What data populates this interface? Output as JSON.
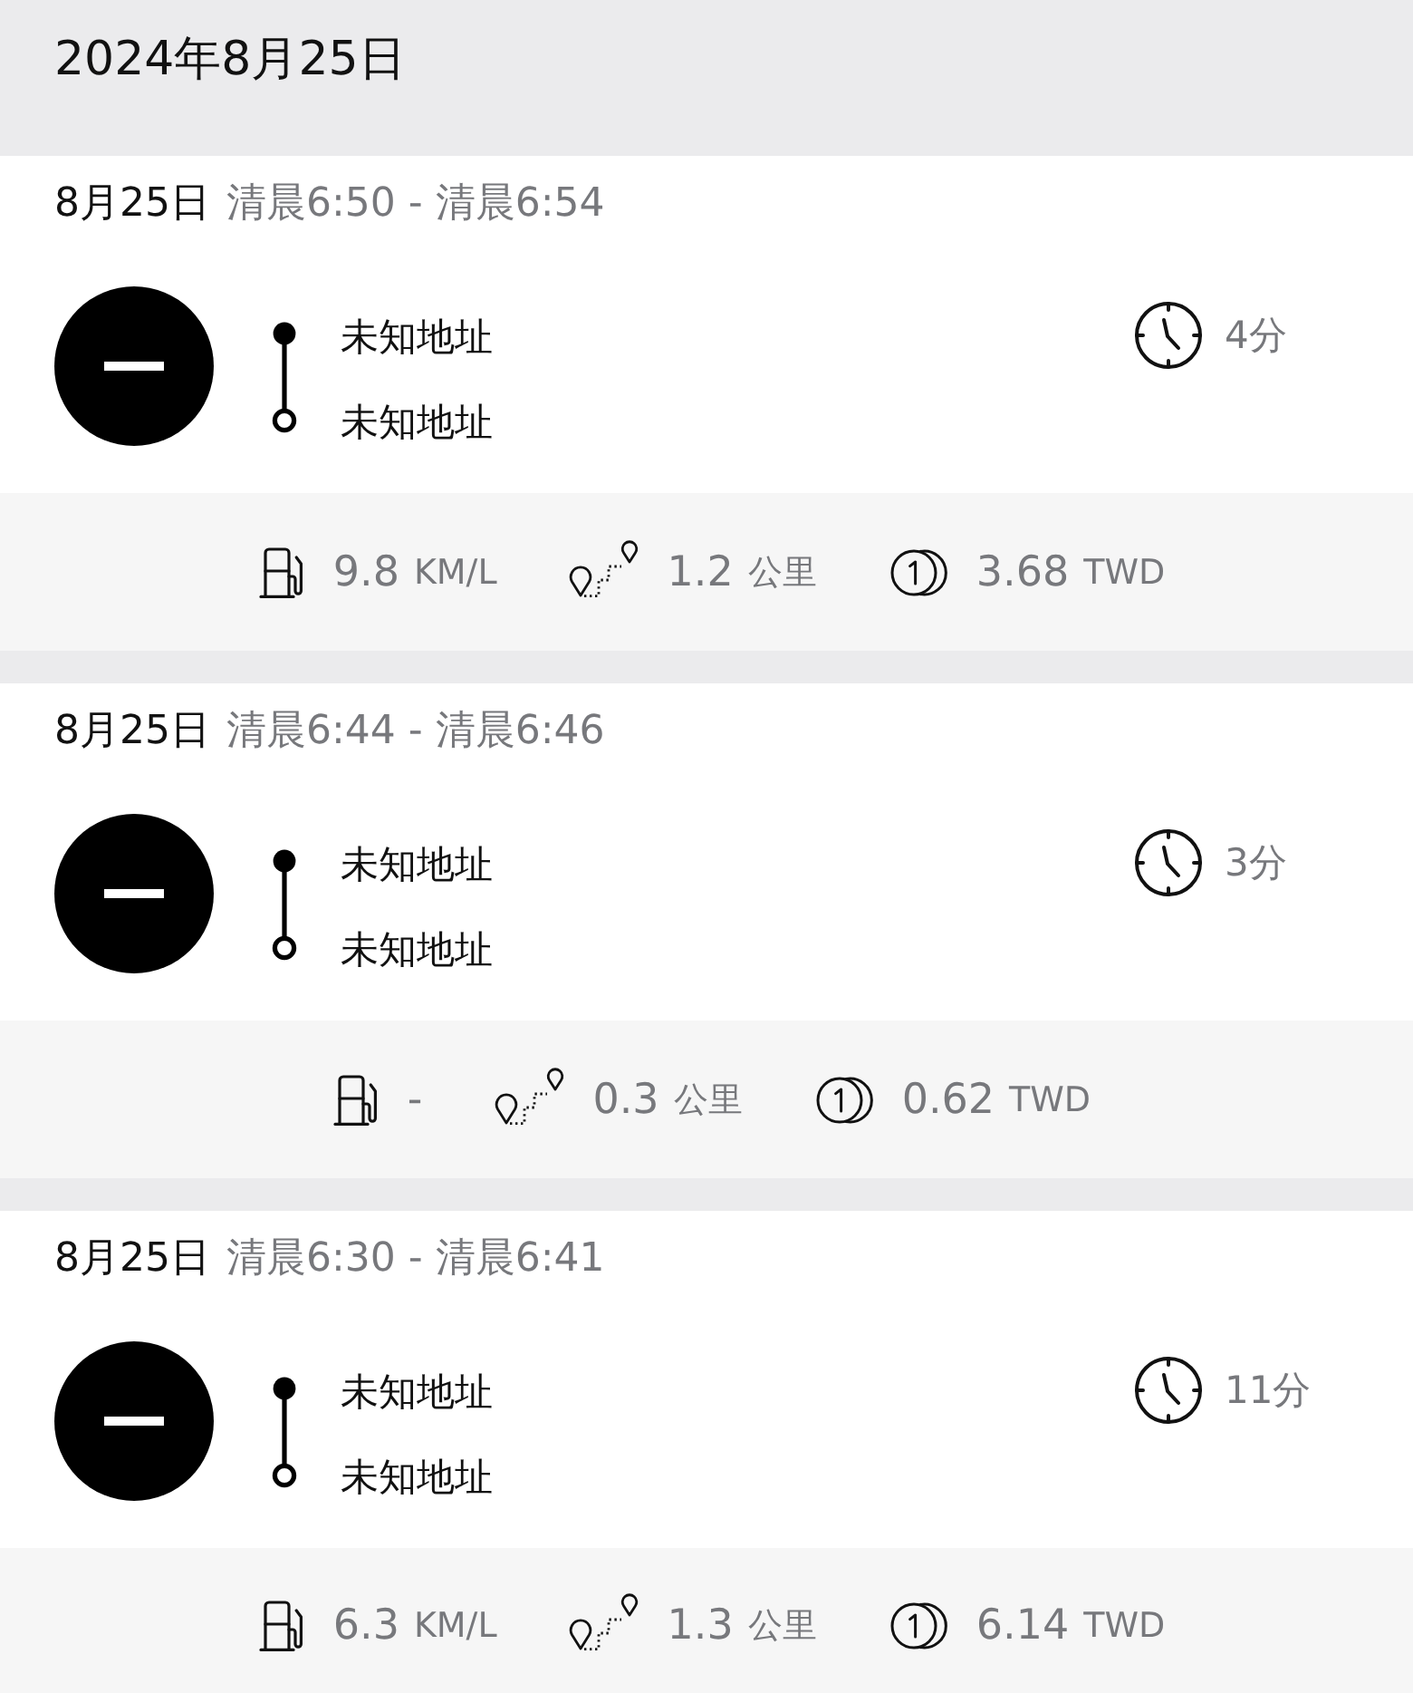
{
  "header": {
    "title": "2024年8月25日"
  },
  "trips": [
    {
      "date": "8月25日",
      "time_range": "清晨6:50 - 清晨6:54",
      "origin": "未知地址",
      "destination": "未知地址",
      "duration": "4分",
      "stats": [
        {
          "kind": "fuel",
          "value": "9.8",
          "unit": "KM/L"
        },
        {
          "kind": "distance",
          "value": "1.2",
          "unit": "公里"
        },
        {
          "kind": "cost",
          "value": "3.68",
          "unit": "TWD"
        }
      ]
    },
    {
      "date": "8月25日",
      "time_range": "清晨6:44 - 清晨6:46",
      "origin": "未知地址",
      "destination": "未知地址",
      "duration": "3分",
      "stats": [
        {
          "kind": "fuel",
          "value": "-"
        },
        {
          "kind": "distance",
          "value": "0.3",
          "unit": "公里"
        },
        {
          "kind": "cost",
          "value": "0.62",
          "unit": "TWD"
        }
      ]
    },
    {
      "date": "8月25日",
      "time_range": "清晨6:30 - 清晨6:41",
      "origin": "未知地址",
      "destination": "未知地址",
      "duration": "11分",
      "stats": [
        {
          "kind": "fuel",
          "value": "6.3",
          "unit": "KM/L"
        },
        {
          "kind": "distance",
          "value": "1.3",
          "unit": "公里"
        },
        {
          "kind": "cost",
          "value": "6.14",
          "unit": "TWD"
        }
      ]
    }
  ]
}
